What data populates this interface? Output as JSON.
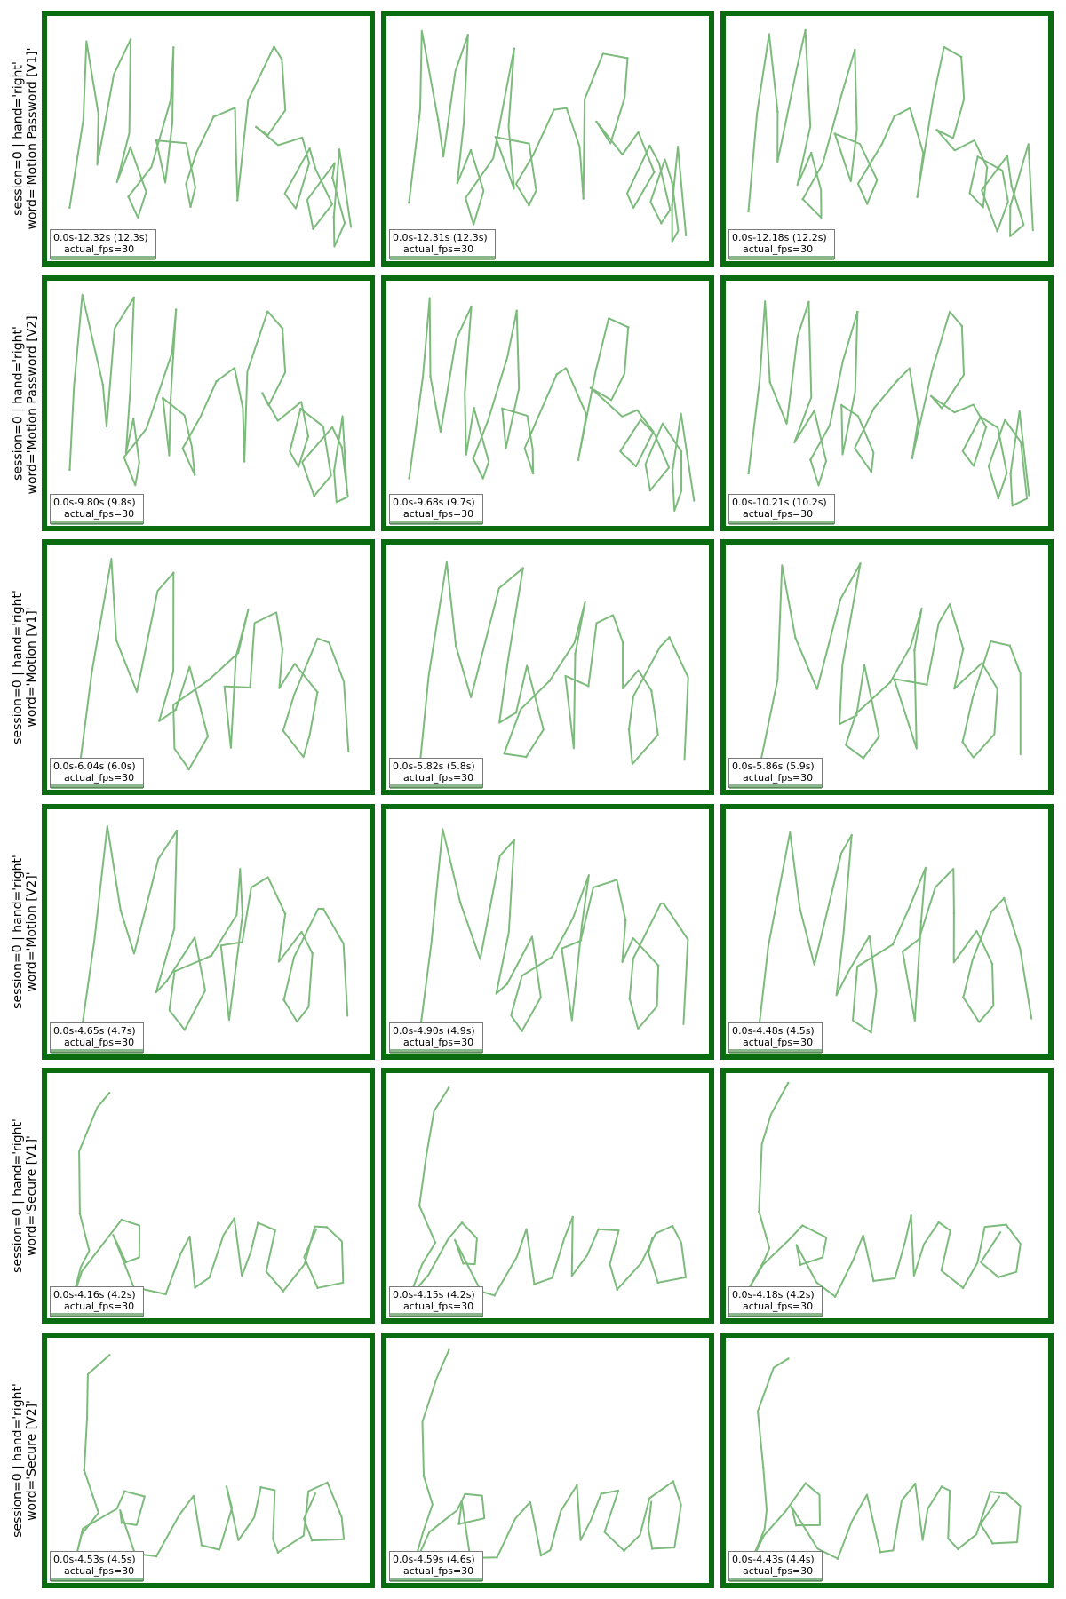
{
  "chart_data": {
    "type": "grid",
    "rows": [
      {
        "label_line1": "session=0 | hand='right'",
        "label_line2": "word='Motion Password [V1]'",
        "word": "MotionPassword",
        "panels": [
          {
            "time_label": "0.0s-12.32s (12.3s)",
            "fps_label": "actual_fps=30",
            "duration_s": 12.32
          },
          {
            "time_label": "0.0s-12.31s (12.3s)",
            "fps_label": "actual_fps=30",
            "duration_s": 12.31
          },
          {
            "time_label": "0.0s-12.18s (12.2s)",
            "fps_label": "actual_fps=30",
            "duration_s": 12.18
          }
        ]
      },
      {
        "label_line1": "session=0 | hand='right'",
        "label_line2": "word='Motion Password [V2]'",
        "word": "MotionPassword",
        "panels": [
          {
            "time_label": "0.0s-9.80s (9.8s)",
            "fps_label": "actual_fps=30",
            "duration_s": 9.8
          },
          {
            "time_label": "0.0s-9.68s (9.7s)",
            "fps_label": "actual_fps=30",
            "duration_s": 9.68
          },
          {
            "time_label": "0.0s-10.21s (10.2s)",
            "fps_label": "actual_fps=30",
            "duration_s": 10.21
          }
        ]
      },
      {
        "label_line1": "session=0 | hand='right'",
        "label_line2": "word='Motion [V1]'",
        "word": "Motion",
        "panels": [
          {
            "time_label": "0.0s-6.04s (6.0s)",
            "fps_label": "actual_fps=30",
            "duration_s": 6.04
          },
          {
            "time_label": "0.0s-5.82s (5.8s)",
            "fps_label": "actual_fps=30",
            "duration_s": 5.82
          },
          {
            "time_label": "0.0s-5.86s (5.9s)",
            "fps_label": "actual_fps=30",
            "duration_s": 5.86
          }
        ]
      },
      {
        "label_line1": "session=0 | hand='right'",
        "label_line2": "word='Motion [V2]'",
        "word": "Motion",
        "panels": [
          {
            "time_label": "0.0s-4.65s (4.7s)",
            "fps_label": "actual_fps=30",
            "duration_s": 4.65
          },
          {
            "time_label": "0.0s-4.90s (4.9s)",
            "fps_label": "actual_fps=30",
            "duration_s": 4.9
          },
          {
            "time_label": "0.0s-4.48s (4.5s)",
            "fps_label": "actual_fps=30",
            "duration_s": 4.48
          }
        ]
      },
      {
        "label_line1": "session=0 | hand='right'",
        "label_line2": "word='Secure [V1]'",
        "word": "Secure",
        "panels": [
          {
            "time_label": "0.0s-4.16s (4.2s)",
            "fps_label": "actual_fps=30",
            "duration_s": 4.16
          },
          {
            "time_label": "0.0s-4.15s (4.2s)",
            "fps_label": "actual_fps=30",
            "duration_s": 4.15
          },
          {
            "time_label": "0.0s-4.18s (4.2s)",
            "fps_label": "actual_fps=30",
            "duration_s": 4.18
          }
        ]
      },
      {
        "label_line1": "session=0 | hand='right'",
        "label_line2": "word='Secure [V2]'",
        "word": "Secure",
        "panels": [
          {
            "time_label": "0.0s-4.53s (4.5s)",
            "fps_label": "actual_fps=30",
            "duration_s": 4.53
          },
          {
            "time_label": "0.0s-4.59s (4.6s)",
            "fps_label": "actual_fps=30",
            "duration_s": 4.59
          },
          {
            "time_label": "0.0s-4.43s (4.4s)",
            "fps_label": "actual_fps=30",
            "duration_s": 4.43
          }
        ]
      }
    ]
  },
  "colors": {
    "panel_border": "#0b6b10",
    "trace": "#7dbb7d",
    "info_bar": "#4f8f4f"
  }
}
